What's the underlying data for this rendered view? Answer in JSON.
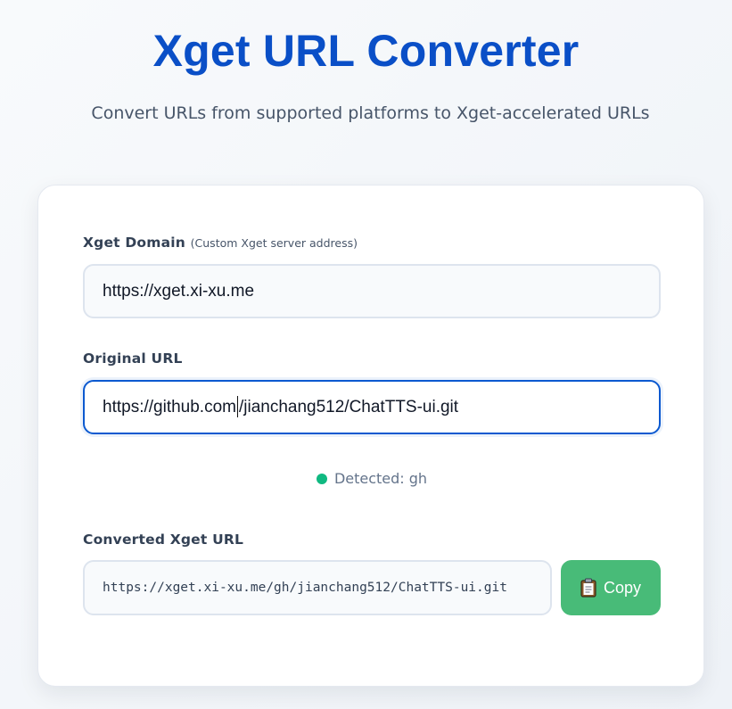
{
  "header": {
    "title": "Xget URL Converter",
    "subtitle": "Convert URLs from supported platforms to Xget-accelerated URLs"
  },
  "form": {
    "domain": {
      "label": "Xget Domain",
      "hint": "(Custom Xget server address)",
      "value": "https://xget.xi-xu.me"
    },
    "original": {
      "label": "Original URL",
      "value_before_caret": "https://github.com",
      "value_after_caret": "/jianchang512/ChatTTS-ui.git"
    },
    "detected": {
      "text": "Detected: gh",
      "status_color": "#10b981"
    },
    "converted": {
      "label": "Converted Xget URL",
      "value": "https://xget.xi-xu.me/gh/jianchang512/ChatTTS-ui.git"
    },
    "copy_button": {
      "label": "Copy",
      "icon": "clipboard-icon",
      "color": "#48bb78"
    }
  },
  "theme": {
    "accent": "#0a4fc7",
    "focus": "#0a59d0"
  }
}
